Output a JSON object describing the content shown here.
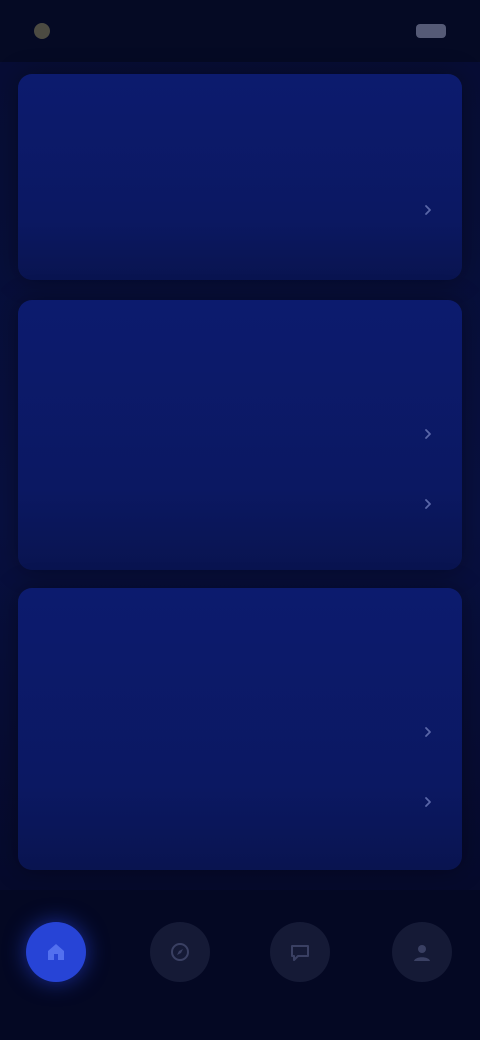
{
  "status_bar": {
    "time": "",
    "signal": ""
  },
  "sections": [
    {
      "title": "",
      "rows": [
        {
          "label": ""
        }
      ]
    },
    {
      "title": "",
      "rows": [
        {
          "label": ""
        },
        {
          "label": ""
        }
      ]
    },
    {
      "title": "",
      "rows": [
        {
          "label": ""
        },
        {
          "label": ""
        }
      ]
    }
  ],
  "bottom_nav": [
    {
      "icon": "home-icon",
      "active": true
    },
    {
      "icon": "compass-icon",
      "active": false
    },
    {
      "icon": "chat-icon",
      "active": false
    },
    {
      "icon": "profile-icon",
      "active": false
    }
  ],
  "colors": {
    "accent": "#2744d6",
    "card": "#0c1b6e",
    "background": "#060b2a"
  }
}
